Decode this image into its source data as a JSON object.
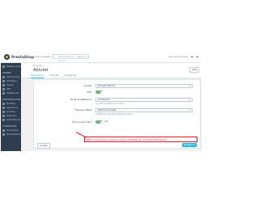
{
  "topbar": {
    "logo_text": "PrestaShop",
    "quick_access": "Accès rapide",
    "search_placeholder": "Rechercher (ex. : référence produit...",
    "right_items": [
      "Voir ma boutique",
      "",
      ""
    ]
  },
  "sidebar": {
    "items": [
      {
        "label": "Tableau de bord",
        "icon": "dashboard-icon"
      },
      {
        "label": "VENDRE",
        "section": true
      },
      {
        "label": "Commandes",
        "icon": "orders-icon"
      },
      {
        "label": "Catalogue",
        "icon": "catalog-icon"
      },
      {
        "label": "Clients",
        "icon": "customers-icon"
      },
      {
        "label": "SAV",
        "icon": "sav-icon"
      },
      {
        "label": "Statistiques",
        "icon": "stats-icon"
      },
      {
        "label": "PERSONNALISER",
        "section": true
      },
      {
        "label": "Modules",
        "icon": "modules-icon"
      },
      {
        "label": "Apparence",
        "icon": "appearance-icon"
      },
      {
        "label": "Livraison",
        "icon": "shipping-icon"
      },
      {
        "label": "Paiement",
        "icon": "payment-icon"
      },
      {
        "label": "International",
        "icon": "international-icon"
      },
      {
        "label": "CONFIGURER",
        "section": true
      },
      {
        "label": "Paramètres",
        "icon": "settings-icon"
      },
      {
        "label": "Paramètres avancés",
        "icon": "advanced-settings-icon"
      }
    ]
  },
  "page": {
    "breadcrumb": "Modules / ...",
    "title": "Ajouter",
    "help_label": "Aide",
    "tabs": [
      "Paramètres",
      "Produits",
      "Catégories"
    ]
  },
  "form": {
    "rows": [
      {
        "label": "Langue",
        "value": "Français (French)",
        "type": "select"
      },
      {
        "label": "Actif",
        "value": "",
        "type": "toggle"
      },
      {
        "label": "Profil de préférence",
        "value": "Commande",
        "type": "select",
        "required": true
      },
      {
        "label": "Nouveau statut",
        "value": "Paiement accepté",
        "type": "select",
        "required": true
      },
      {
        "label": "Envoi e-mail client",
        "value": "Oui",
        "type": "toggle"
      }
    ],
    "help_texts": [
      "Le profil de préférence du client...",
      "Le statut de commande appliqué lorsque..."
    ]
  },
  "notice": "Définir un profil pour un pays ou une pour les statuts de commande automatiques.",
  "buttons": {
    "cancel": "Annuler",
    "save": "Enregistrer"
  },
  "colors": {
    "accent": "#25b9d7",
    "sidebar": "#2c3e50",
    "highlight": "#e0142d",
    "toggle_on": "#70b580"
  }
}
